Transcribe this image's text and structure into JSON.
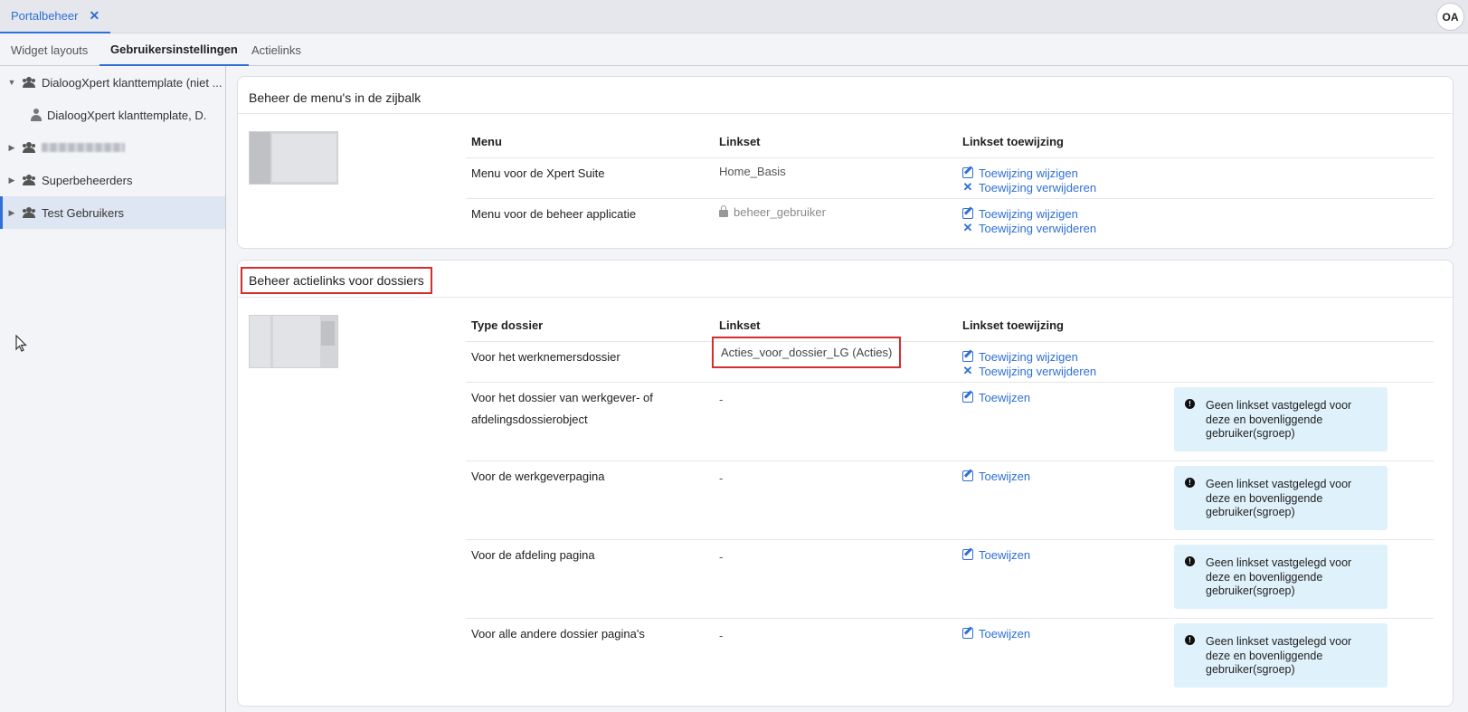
{
  "app_tab": {
    "label": "Portalbeheer",
    "close": "✕"
  },
  "user": {
    "initials": "OA"
  },
  "subtabs": [
    "Widget layouts",
    "Gebruikersinstellingen",
    "Actielinks"
  ],
  "sidebar": {
    "items": [
      {
        "label": "DialoogXpert klanttemplate (niet ...",
        "type": "group",
        "expanded": true
      },
      {
        "label": "DialoogXpert klanttemplate, D.",
        "type": "user"
      },
      {
        "label": "",
        "type": "group",
        "blurred": true
      },
      {
        "label": "Superbeheerders",
        "type": "group"
      },
      {
        "label": "Test Gebruikers",
        "type": "group",
        "selected": true
      }
    ]
  },
  "menus_panel": {
    "title": "Beheer de menu's in de zijbalk",
    "headers": {
      "col1": "Menu",
      "col2": "Linkset",
      "col3": "Linkset toewijzing"
    },
    "rows": [
      {
        "name": "Menu voor de Xpert Suite",
        "linkset": "Home_Basis",
        "locked": false,
        "edit": "Toewijzing wijzigen",
        "remove": "Toewijzing verwijderen"
      },
      {
        "name": "Menu voor de beheer applicatie",
        "linkset": "beheer_gebruiker",
        "locked": true,
        "edit": "Toewijzing wijzigen",
        "remove": "Toewijzing verwijderen"
      }
    ]
  },
  "actions_panel": {
    "title": "Beheer actielinks voor dossiers",
    "headers": {
      "col1": "Type dossier",
      "col2": "Linkset",
      "col3": "Linkset toewijzing"
    },
    "rows": [
      {
        "name": "Voor het werknemersdossier",
        "linkset": "Acties_voor_dossier_LG (Acties)",
        "edit": "Toewijzing wijzigen",
        "remove": "Toewijzing verwijderen"
      },
      {
        "name_line1": "Voor het dossier van werkgever- of",
        "name_line2": "afdelingsdossierobject",
        "linkset": "-",
        "assign": "Toewijzen",
        "notice": "Geen linkset vastgelegd voor deze en bovenliggende gebruiker(sgroep)"
      },
      {
        "name": "Voor de werkgeverpagina",
        "linkset": "-",
        "assign": "Toewijzen",
        "notice": "Geen linkset vastgelegd voor deze en bovenliggende gebruiker(sgroep)"
      },
      {
        "name": "Voor de afdeling pagina",
        "linkset": "-",
        "assign": "Toewijzen",
        "notice": "Geen linkset vastgelegd voor deze en bovenliggende gebruiker(sgroep)"
      },
      {
        "name": "Voor alle andere dossier pagina's",
        "linkset": "-",
        "assign": "Toewijzen",
        "notice": "Geen linkset vastgelegd voor deze en bovenliggende gebruiker(sgroep)"
      }
    ]
  },
  "colors": {
    "accent": "#2f6fd6",
    "highlight": "#d32f2f",
    "notice_bg": "#dff1fb",
    "selected_bg": "#dfe6f3"
  }
}
